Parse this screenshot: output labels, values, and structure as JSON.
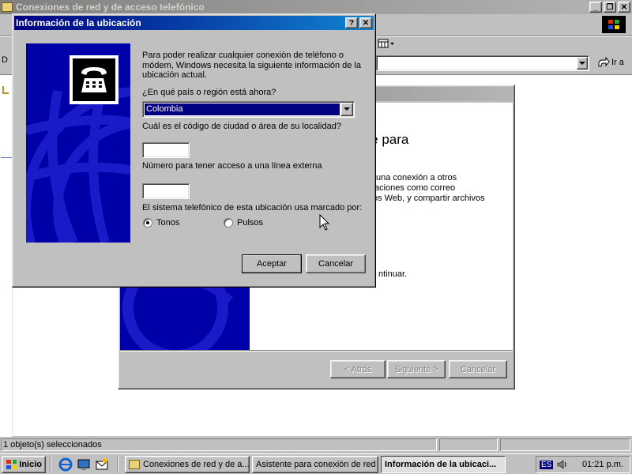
{
  "main_window": {
    "title": "Conexiones de red y de acceso telefónico",
    "address_label_partial": "D",
    "go_label": "Ir a",
    "status_text": "1 objeto(s) seleccionados"
  },
  "wizard": {
    "heading_partial": "nte para",
    "body_lines": [
      "una conexión a otros",
      "aciones como correo",
      "os Web, y compartir archivos"
    ],
    "continue_partial": "ntinuar.",
    "back_label": "< Atrás",
    "next_label": "Siguiente >",
    "cancel_label": "Cancelar"
  },
  "dialog": {
    "title": "Información de la ubicación",
    "intro": "Para poder realizar cualquier conexión de teléfono o módem, Windows necesita la siguiente información de la ubicación actual.",
    "country_question": "¿En qué país o región está ahora?",
    "country_value": "Colombia",
    "area_code_label": "Cuál es el código de ciudad o área de su localidad?",
    "area_code_value": "",
    "outside_line_label": "Número para tener acceso a una línea externa",
    "outside_line_value": "",
    "dialing_label": "El sistema telefónico de esta ubicación usa marcado por:",
    "tone_label": "Tonos",
    "pulse_label": "Pulsos",
    "dialing_selected": "Tonos",
    "ok_label": "Aceptar",
    "cancel_label": "Cancelar"
  },
  "taskbar": {
    "start_label": "Inicio",
    "tasks": [
      "Conexiones de red y de a...",
      "Asistente para conexión de red",
      "Información de la ubicaci..."
    ],
    "language": "ES",
    "clock": "01:21 p.m."
  },
  "colors": {
    "title_active": "#000080",
    "title_inactive": "#808080",
    "face": "#c0c0c0",
    "selection": "#000080",
    "wizard_graphic": "#0000a8"
  }
}
